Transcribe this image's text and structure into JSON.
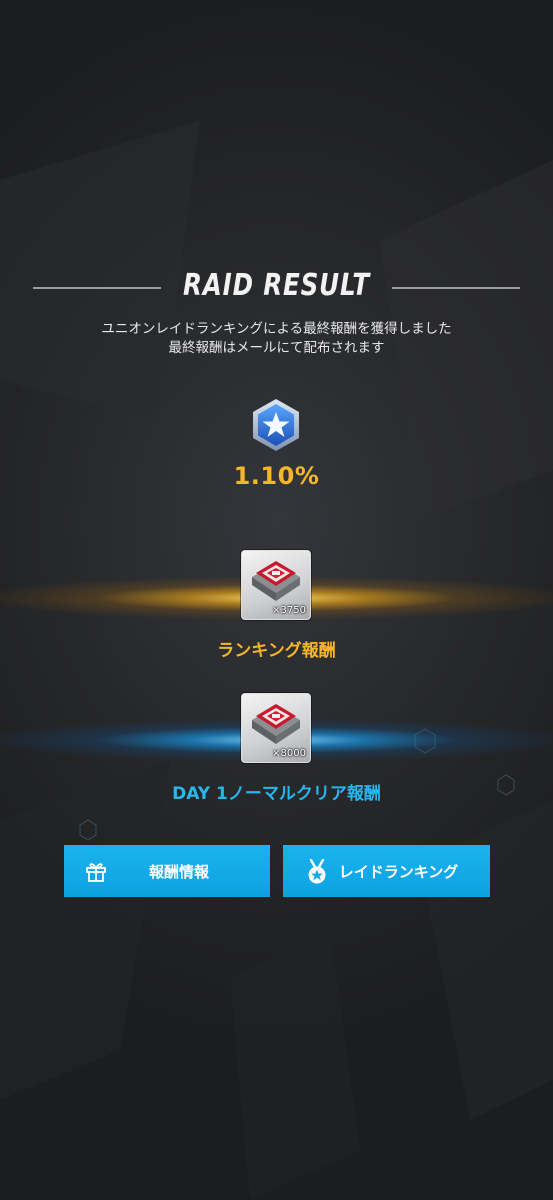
{
  "header": {
    "title": "RAID RESULT",
    "subtitle_line1": "ユニオンレイドランキングによる最終報酬を獲得しました",
    "subtitle_line2": "最終報酬はメールにて配布されます"
  },
  "rank": {
    "badge_icon": "star-shield-icon",
    "percent": "1.10%"
  },
  "rewards": [
    {
      "icon": "chip-item-icon",
      "quantity": "×3750",
      "label": "ランキング報酬",
      "color": "#f6b628"
    },
    {
      "icon": "chip-item-icon",
      "quantity": "×8000",
      "label": "DAY 1ノーマルクリア報酬",
      "color": "#25b8ef"
    }
  ],
  "buttons": {
    "reward_info": {
      "label": "報酬情報",
      "icon": "gift-icon"
    },
    "raid_ranking": {
      "label": "レイドランキング",
      "icon": "medal-icon"
    }
  },
  "colors": {
    "accent_gold": "#f6b628",
    "accent_blue": "#25b8ef",
    "button_blue": "#12a9e8"
  }
}
